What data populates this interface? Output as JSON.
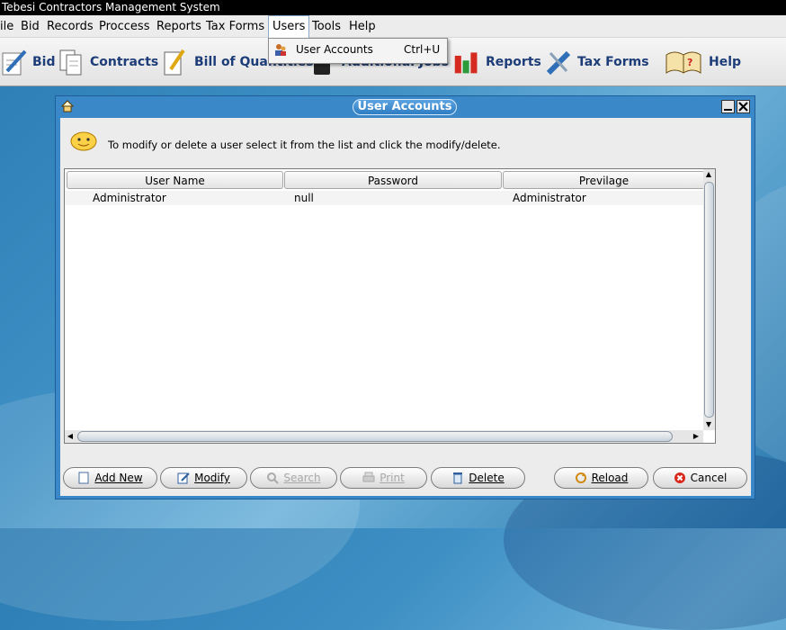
{
  "app_title": "Tebesi Contractors Management System",
  "menubar": {
    "items": [
      "ile",
      "Bid",
      "Records",
      "Proccess",
      "Reports",
      "Tax Forms",
      "Users",
      "Tools",
      "Help"
    ],
    "active": "Users"
  },
  "dropdown": {
    "items": [
      {
        "label": "User Accounts",
        "shortcut": "Ctrl+U",
        "icon": "users-icon"
      }
    ]
  },
  "toolbar": {
    "items": [
      {
        "label": "Bid",
        "icon": "pen-paper-icon"
      },
      {
        "label": "Contracts",
        "icon": "documents-icon"
      },
      {
        "label": "Bill of Quantities",
        "icon": "pencil-paper-icon"
      },
      {
        "label": "Additional Jobs",
        "icon": "calculator-icon"
      },
      {
        "label": "Reports",
        "icon": "bar-chart-icon"
      },
      {
        "label": "Tax Forms",
        "icon": "tools-icon"
      },
      {
        "label": "Help",
        "icon": "book-icon"
      }
    ]
  },
  "window": {
    "title": "User Accounts",
    "instruction": "To modify or delete a user select it from the list and click the modify/delete.",
    "table": {
      "columns": [
        "User Name",
        "Password",
        "Previlage"
      ],
      "rows": [
        [
          "Administrator",
          "null",
          "Administrator"
        ]
      ]
    },
    "buttons": {
      "add_new": "Add New",
      "modify": "Modify",
      "search": "Search",
      "print": "Print",
      "delete": "Delete",
      "reload": "Reload",
      "cancel": "Cancel"
    }
  },
  "colors": {
    "window_frame": "#3b88c8",
    "toolbar_text": "#1d3d78",
    "desktop": "#2b7cb3"
  }
}
